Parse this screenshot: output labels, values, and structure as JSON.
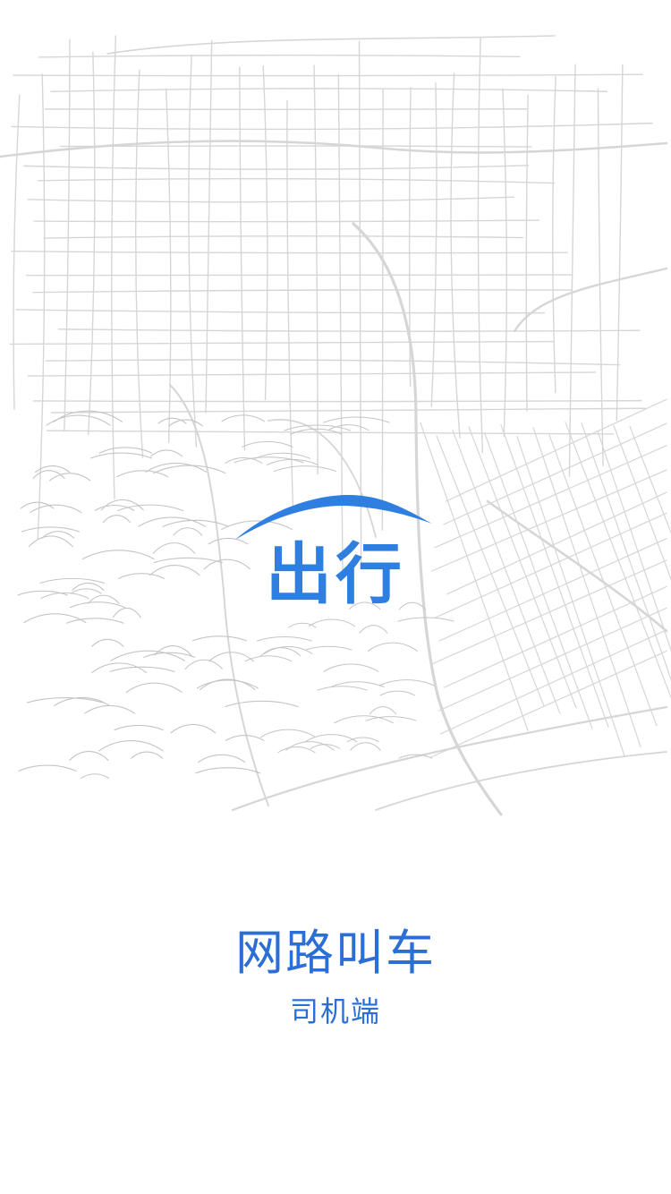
{
  "app": {
    "logo_text": "出行",
    "title": "网路叫车",
    "subtitle": "司机端"
  },
  "illustration": {
    "icon": "city-map-illustration"
  },
  "colors": {
    "brand": "#2f7fe0",
    "title": "#2b6fd6",
    "map_line": "#d6d6d6",
    "map_line_dark": "#c4c4c4",
    "background": "#ffffff"
  }
}
